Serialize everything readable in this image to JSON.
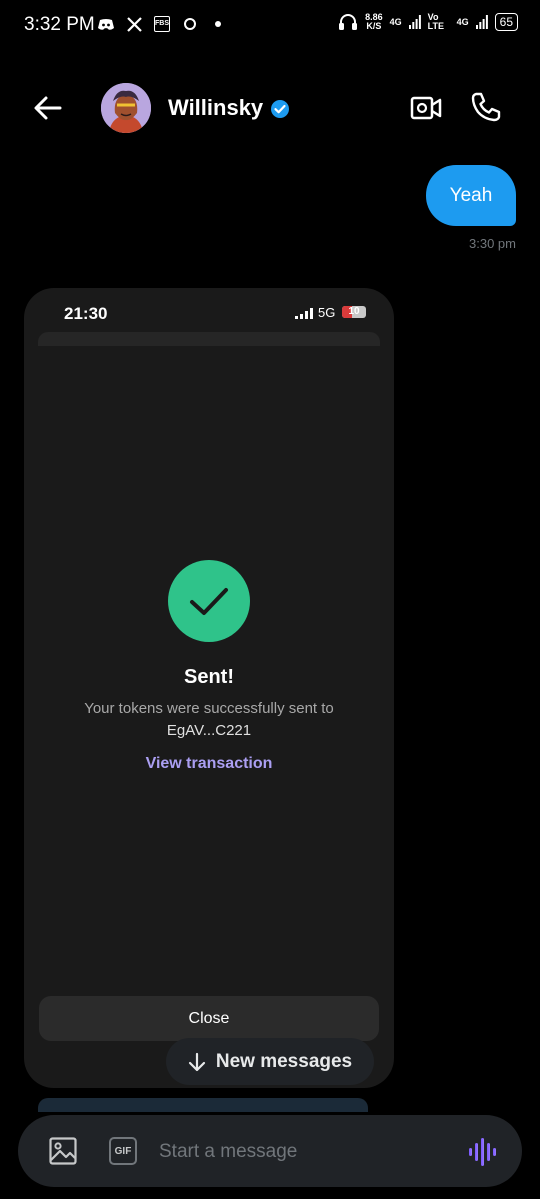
{
  "status_bar": {
    "time": "3:32 PM",
    "net_speed_value": "8.86",
    "net_speed_unit": "K/S",
    "net1": "4G",
    "volte": "Vo LTE",
    "net2": "4G",
    "battery": "65"
  },
  "header": {
    "name": "Willinsky",
    "verified_color": "#1d9bf0"
  },
  "messages": [
    {
      "text": "Yeah",
      "time": "3:30 pm"
    }
  ],
  "attachment": {
    "status_time": "21:30",
    "network": "5G",
    "battery": "10",
    "battery_level": 0.1,
    "title": "Sent!",
    "body": "Your tokens were successfully sent to",
    "address": "EgAV...C221",
    "link": "View transaction",
    "close_label": "Close",
    "accent": "#2fc38a",
    "link_color": "#ab9ff2"
  },
  "new_messages_label": "New messages",
  "composer": {
    "gif_label": "GIF",
    "placeholder": "Start a message",
    "voice_color": "#7856ff"
  }
}
